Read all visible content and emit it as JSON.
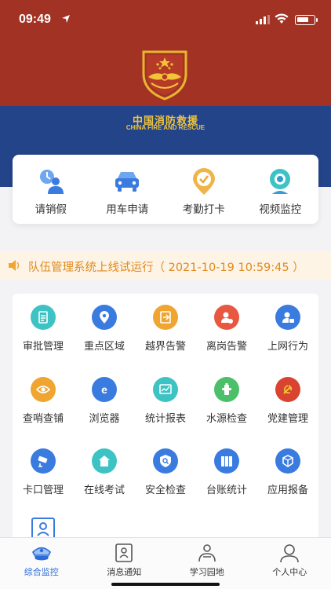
{
  "status_bar": {
    "time": "09:49"
  },
  "header": {
    "title_cn": "中国消防救援",
    "title_en": "CHINA FIRE AND RESCUE"
  },
  "quick_actions": [
    {
      "label": "请销假",
      "icon": "leave-icon"
    },
    {
      "label": "用车申请",
      "icon": "car-icon"
    },
    {
      "label": "考勤打卡",
      "icon": "checkin-icon"
    },
    {
      "label": "视频监控",
      "icon": "camera-icon"
    }
  ],
  "notice": {
    "text": "队伍管理系统上线试运行（ 2021-10-19 10:59:45 ）"
  },
  "grid_items": [
    {
      "label": "审批管理",
      "icon": "approval-icon",
      "color": "#3ec3c4"
    },
    {
      "label": "重点区域",
      "icon": "location-icon",
      "color": "#3a7be0"
    },
    {
      "label": "越界告警",
      "icon": "exit-icon",
      "color": "#f0a530"
    },
    {
      "label": "离岗告警",
      "icon": "user-alert-icon",
      "color": "#e8573f"
    },
    {
      "label": "上网行为",
      "icon": "network-user-icon",
      "color": "#3a7be0"
    },
    {
      "label": "查哨查铺",
      "icon": "eye-icon",
      "color": "#f0a530"
    },
    {
      "label": "浏览器",
      "icon": "browser-icon",
      "color": "#3a7be0"
    },
    {
      "label": "统计报表",
      "icon": "chart-icon",
      "color": "#3ec3c4"
    },
    {
      "label": "水源检查",
      "icon": "hydrant-icon",
      "color": "#4cbf6a"
    },
    {
      "label": "党建管理",
      "icon": "party-icon",
      "color": "#d9432f"
    },
    {
      "label": "卡口管理",
      "icon": "cctv-icon",
      "color": "#3a7be0"
    },
    {
      "label": "在线考试",
      "icon": "exam-icon",
      "color": "#3ec3c4"
    },
    {
      "label": "安全检查",
      "icon": "shield-search-icon",
      "color": "#3a7be0"
    },
    {
      "label": "台账统计",
      "icon": "ledger-icon",
      "color": "#3a7be0"
    },
    {
      "label": "应用报备",
      "icon": "cube-icon",
      "color": "#3a7be0"
    }
  ],
  "nav": [
    {
      "label": "综合监控",
      "icon": "police-cap-icon",
      "active": true
    },
    {
      "label": "消息通知",
      "icon": "message-icon",
      "active": false
    },
    {
      "label": "学习园地",
      "icon": "study-icon",
      "active": false
    },
    {
      "label": "个人中心",
      "icon": "user-icon",
      "active": false
    }
  ],
  "colors": {
    "header_red": "#a23223",
    "header_blue": "#234488",
    "notice_text": "#e08a1f",
    "active_blue": "#2c6bd8"
  }
}
